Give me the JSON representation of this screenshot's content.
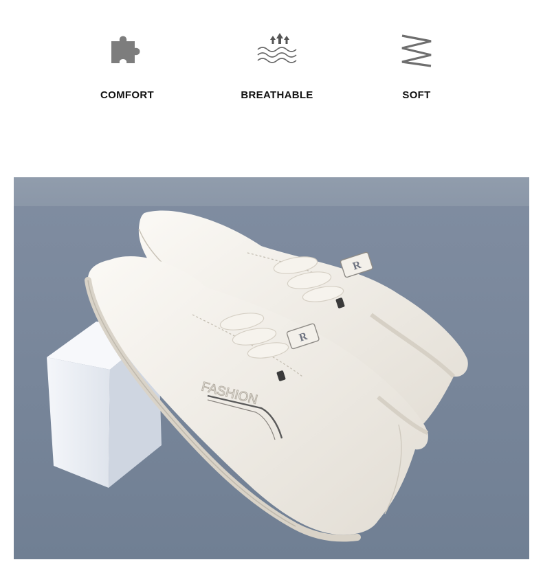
{
  "features": [
    {
      "label": "COMFORT",
      "icon": "puzzle-piece-icon"
    },
    {
      "label": "BREATHABLE",
      "icon": "airflow-waves-icon"
    },
    {
      "label": "SOFT",
      "icon": "zigzag-spring-icon"
    }
  ],
  "photo": {
    "embroidery_text": "FASHION",
    "badge_letter": "R",
    "colors": {
      "backdrop_top": "#8c98a8",
      "backdrop_floor": "#6f7d90",
      "shoe": "#efebe3",
      "block": "#e9edf3"
    }
  }
}
